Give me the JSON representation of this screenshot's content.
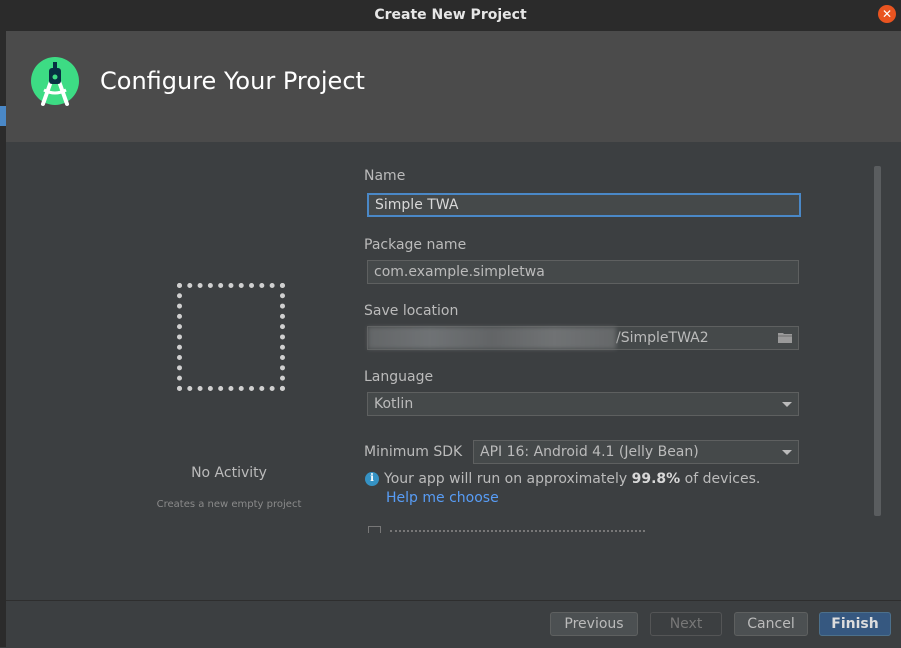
{
  "window": {
    "title": "Create New Project",
    "close_icon": "close-icon"
  },
  "header": {
    "title": "Configure Your Project",
    "logo_icon": "android-studio-icon"
  },
  "template": {
    "name": "No Activity",
    "description": "Creates a new empty project"
  },
  "form": {
    "name": {
      "label": "Name",
      "value": "Simple TWA"
    },
    "package": {
      "label": "Package name",
      "value": "com.example.simpletwa"
    },
    "save_location": {
      "label": "Save location",
      "value": "/SimpleTWA2"
    },
    "language": {
      "label": "Language",
      "value": "Kotlin"
    },
    "min_sdk": {
      "label": "Minimum SDK",
      "value": "API 16: Android 4.1 (Jelly Bean)"
    },
    "info": {
      "prefix": "Your app will run on approximately ",
      "percent": "99.8%",
      "suffix": " of devices."
    },
    "help_link": "Help me choose"
  },
  "buttons": {
    "previous": "Previous",
    "next": "Next",
    "cancel": "Cancel",
    "finish": "Finish"
  },
  "colors": {
    "accent": "#4a88c7",
    "primary_button": "#365880",
    "link": "#589df6",
    "close": "#e95420"
  }
}
